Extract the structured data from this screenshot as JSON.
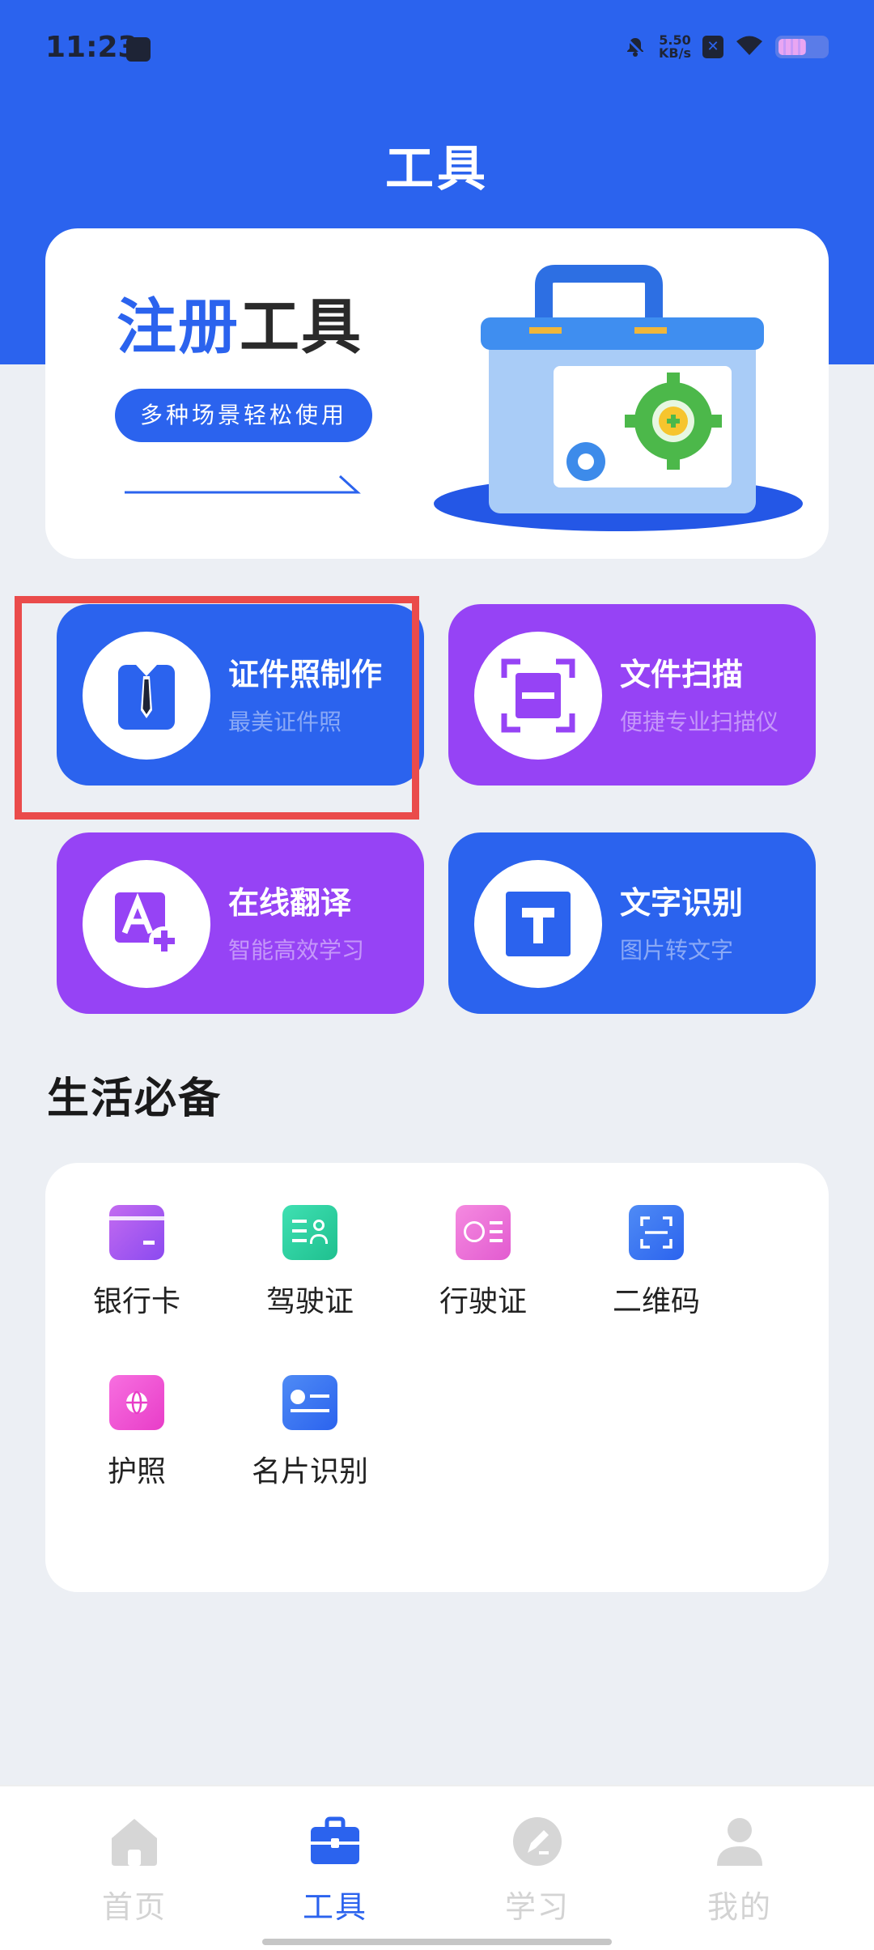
{
  "status_bar": {
    "time": "11:23",
    "net_speed_value": "5.50",
    "net_speed_unit": "KB/s"
  },
  "header": {
    "title": "工具"
  },
  "banner": {
    "title_blue": "注册",
    "title_dark": "工具",
    "pill": "多种场景轻松使用"
  },
  "features": [
    {
      "title": "证件照制作",
      "subtitle": "最美证件照",
      "icon": "id-photo-icon"
    },
    {
      "title": "文件扫描",
      "subtitle": "便捷专业扫描仪",
      "icon": "scan-icon"
    },
    {
      "title": "在线翻译",
      "subtitle": "智能高效学习",
      "icon": "translate-icon"
    },
    {
      "title": "文字识别",
      "subtitle": "图片转文字",
      "icon": "text-recognition-icon"
    }
  ],
  "life": {
    "section_title": "生活必备",
    "items": [
      {
        "label": "银行卡",
        "icon": "bank-card-icon"
      },
      {
        "label": "驾驶证",
        "icon": "driver-license-icon"
      },
      {
        "label": "行驶证",
        "icon": "vehicle-license-icon"
      },
      {
        "label": "二维码",
        "icon": "qr-code-icon"
      },
      {
        "label": "护照",
        "icon": "passport-icon"
      },
      {
        "label": "名片识别",
        "icon": "business-card-icon"
      }
    ]
  },
  "bottom_nav": [
    {
      "label": "首页",
      "icon": "home-icon",
      "active": false
    },
    {
      "label": "工具",
      "icon": "toolbox-icon",
      "active": true
    },
    {
      "label": "学习",
      "icon": "study-icon",
      "active": false
    },
    {
      "label": "我的",
      "icon": "profile-icon",
      "active": false
    }
  ],
  "colors": {
    "primary": "#2b63ee",
    "purple": "#9643f5",
    "highlight": "#ea4b4b",
    "background": "#eceff4"
  }
}
